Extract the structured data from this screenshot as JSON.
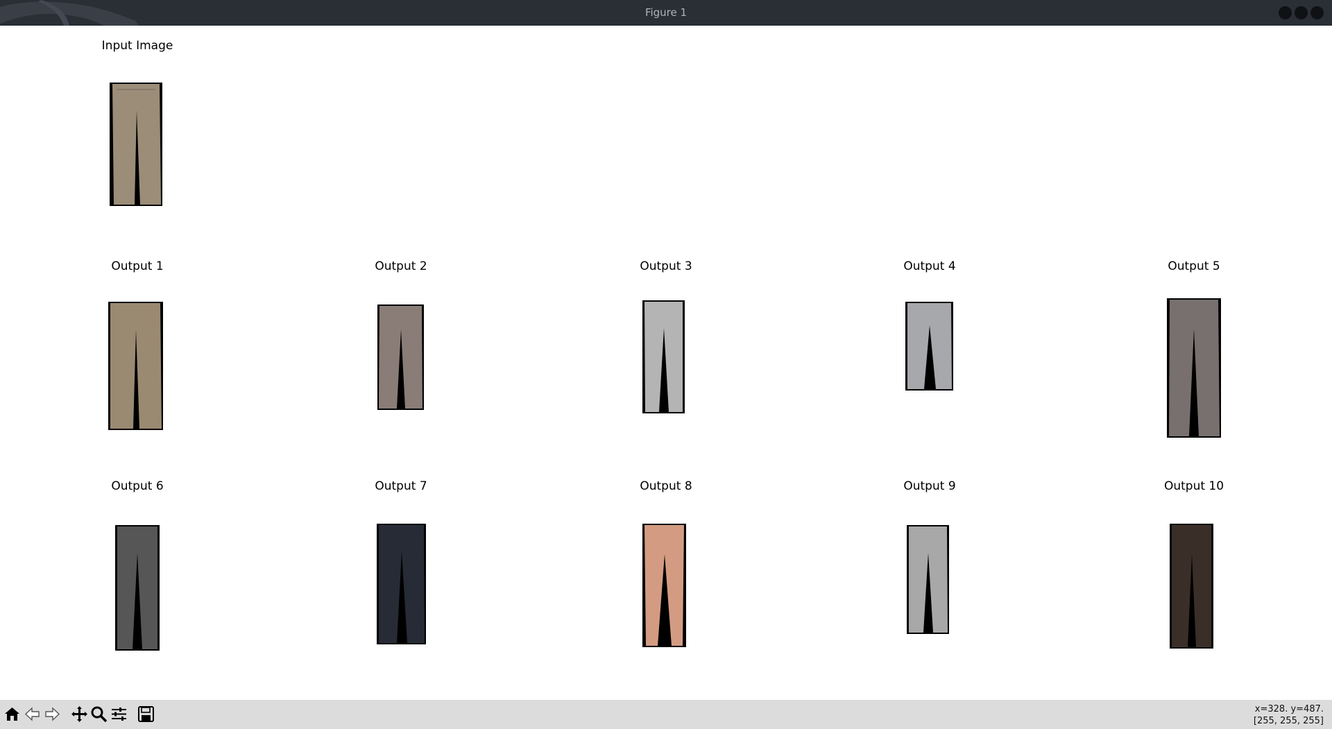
{
  "window": {
    "title": "Figure 1"
  },
  "figure": {
    "input_title": "Input Image",
    "outputs": [
      {
        "title": "Output 1",
        "garment": "pants",
        "color": "#9a8a72"
      },
      {
        "title": "Output 2",
        "garment": "pants",
        "color": "#8a7c76"
      },
      {
        "title": "Output 3",
        "garment": "pants",
        "color": "#b4b4b4"
      },
      {
        "title": "Output 4",
        "garment": "pants",
        "color": "#a6a8ab"
      },
      {
        "title": "Output 5",
        "garment": "pants",
        "color": "#78706e"
      },
      {
        "title": "Output 6",
        "garment": "pants",
        "color": "#565656"
      },
      {
        "title": "Output 7",
        "garment": "pants",
        "color": "#262b36"
      },
      {
        "title": "Output 8",
        "garment": "pants",
        "color": "#d39c82"
      },
      {
        "title": "Output 9",
        "garment": "pants",
        "color": "#a8a8a8"
      },
      {
        "title": "Output 10",
        "garment": "pants",
        "color": "#3a2e28"
      }
    ],
    "input_color": "#9b8d78"
  },
  "toolbar": {
    "buttons": [
      {
        "icon": "home-icon"
      },
      {
        "icon": "back-arrow-icon"
      },
      {
        "icon": "forward-arrow-icon"
      },
      {
        "icon": "pan-move-icon"
      },
      {
        "icon": "zoom-magnifier-icon"
      },
      {
        "icon": "subplots-config-icon"
      },
      {
        "icon": "save-floppy-icon"
      }
    ],
    "coords_line1": "x=328. y=487.",
    "coords_line2": "[255, 255, 255]"
  }
}
